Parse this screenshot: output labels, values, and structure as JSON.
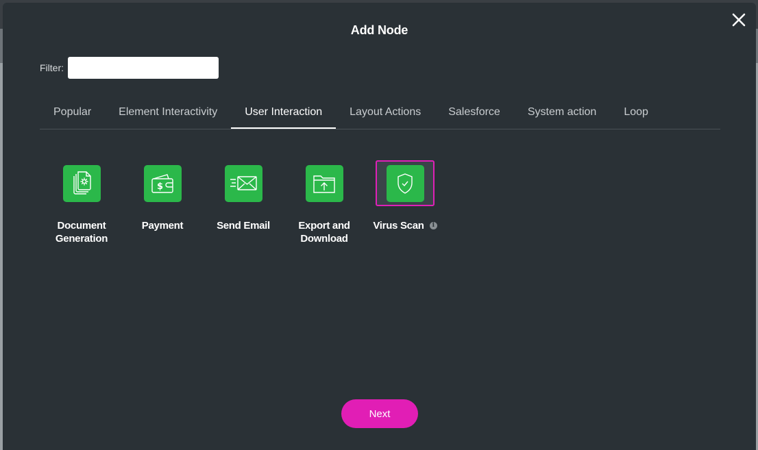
{
  "modal": {
    "title": "Add Node",
    "close_icon": "close-icon"
  },
  "filter": {
    "label": "Filter:",
    "value": "",
    "placeholder": ""
  },
  "tabs": [
    {
      "label": "Popular",
      "active": false
    },
    {
      "label": "Element Interactivity",
      "active": false
    },
    {
      "label": "User Interaction",
      "active": true
    },
    {
      "label": "Layout Actions",
      "active": false
    },
    {
      "label": "Salesforce",
      "active": false
    },
    {
      "label": "System action",
      "active": false
    },
    {
      "label": "Loop",
      "active": false
    }
  ],
  "nodes": [
    {
      "label": "Document Generation",
      "icon": "document-generation-icon"
    },
    {
      "label": "Payment",
      "icon": "wallet-icon"
    },
    {
      "label": "Send Email",
      "icon": "email-icon"
    },
    {
      "label": "Export and Download",
      "icon": "folder-upload-icon"
    },
    {
      "label": "Virus Scan",
      "icon": "shield-check-icon",
      "selected": true
    }
  ],
  "footer": {
    "next_label": "Next"
  },
  "colors": {
    "modal_bg": "#2a3136",
    "node_green": "#2bb84a",
    "accent_magenta": "#e11eb5"
  }
}
